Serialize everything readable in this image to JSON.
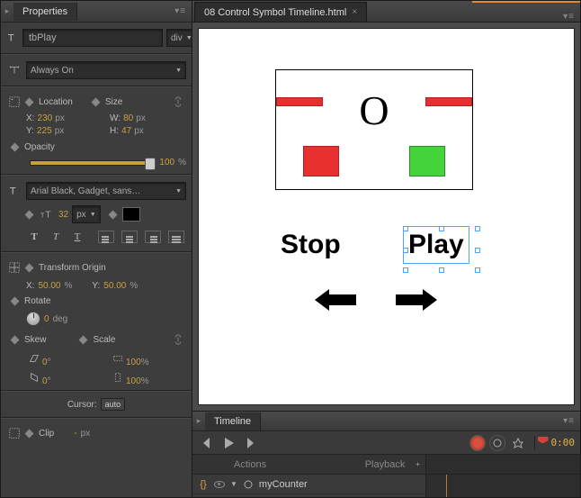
{
  "panel": {
    "tab_arrow": "▸",
    "tab_title": "Properties",
    "element_name": "tbPlay",
    "element_tag": "div",
    "display": {
      "label": "Always On"
    },
    "location": {
      "title": "Location",
      "x_label": "X:",
      "x": "230",
      "y_label": "Y:",
      "y": "225",
      "unit": "px"
    },
    "size": {
      "title": "Size",
      "w_label": "W:",
      "w": "80",
      "h_label": "H:",
      "h": "47",
      "unit": "px"
    },
    "opacity": {
      "title": "Opacity",
      "value": "100",
      "unit": "%"
    },
    "font": {
      "family": "Arial Black, Gadget, sans…",
      "size": "32",
      "unit": "px"
    },
    "transform": {
      "title": "Transform Origin",
      "x_label": "X:",
      "x": "50.00",
      "y_label": "Y:",
      "y": "50.00",
      "unit": "%",
      "rotate_title": "Rotate",
      "rotate": "0",
      "rotate_unit": "deg",
      "skew_title": "Skew",
      "skew_x": "0",
      "skew_y": "0",
      "skew_unit": "°",
      "scale_title": "Scale",
      "scale_x": "100",
      "scale_y": "100",
      "scale_unit": "%"
    },
    "cursor": {
      "label": "Cursor:",
      "value": "auto"
    },
    "clip": {
      "title": "Clip",
      "dash": "-",
      "unit": "px"
    }
  },
  "document": {
    "tab_title": "08 Control Symbol Timeline.html",
    "close": "×"
  },
  "stage": {
    "letter": "O",
    "stop": "Stop",
    "play": "Play"
  },
  "timeline": {
    "tab_title": "Timeline",
    "time": "0:00",
    "actions_header": "Actions",
    "playback_header": "Playback",
    "row1": "myCounter"
  }
}
